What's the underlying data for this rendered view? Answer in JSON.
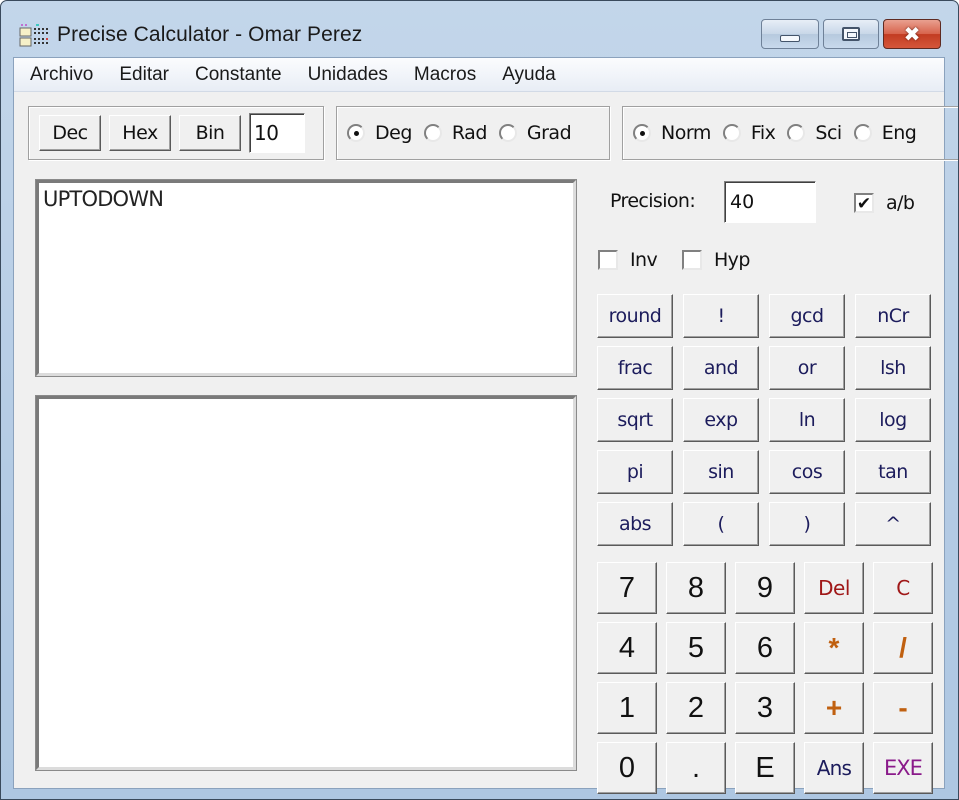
{
  "window": {
    "title": "Precise Calculator - Omar Perez",
    "app_icon": "calculator-icon",
    "controls": {
      "minimize": "minimize-icon",
      "maximize": "maximize-icon",
      "close": "✖"
    }
  },
  "menu": [
    "Archivo",
    "Editar",
    "Constante",
    "Unidades",
    "Macros",
    "Ayuda"
  ],
  "base_group": {
    "buttons": [
      "Dec",
      "Hex",
      "Bin"
    ],
    "base_value": "10"
  },
  "angle_group": {
    "options": [
      {
        "label": "Deg",
        "selected": true
      },
      {
        "label": "Rad",
        "selected": false
      },
      {
        "label": "Grad",
        "selected": false
      }
    ]
  },
  "format_group": {
    "options": [
      {
        "label": "Norm",
        "selected": true
      },
      {
        "label": "Fix",
        "selected": false
      },
      {
        "label": "Sci",
        "selected": false
      },
      {
        "label": "Eng",
        "selected": false
      }
    ]
  },
  "input_area": {
    "value": "UPTODOWN"
  },
  "output_area": {
    "value": ""
  },
  "precision": {
    "label": "Precision:",
    "value": "40"
  },
  "checkboxes": {
    "fraction": {
      "label": "a/b",
      "checked": true,
      "mark": "✔"
    },
    "inv": {
      "label": "Inv",
      "checked": false,
      "mark": ""
    },
    "hyp": {
      "label": "Hyp",
      "checked": false,
      "mark": ""
    }
  },
  "function_buttons": [
    "round",
    "!",
    "gcd",
    "nCr",
    "frac",
    "and",
    "or",
    "lsh",
    "sqrt",
    "exp",
    "ln",
    "log",
    "pi",
    "sin",
    "cos",
    "tan",
    "abs",
    "(",
    ")",
    "^"
  ],
  "keypad": [
    {
      "label": "7",
      "style": "digit"
    },
    {
      "label": "8",
      "style": "digit"
    },
    {
      "label": "9",
      "style": "digit"
    },
    {
      "label": "Del",
      "style": "red"
    },
    {
      "label": "C",
      "style": "red"
    },
    {
      "label": "4",
      "style": "digit"
    },
    {
      "label": "5",
      "style": "digit"
    },
    {
      "label": "6",
      "style": "digit"
    },
    {
      "label": "*",
      "style": "orange"
    },
    {
      "label": "/",
      "style": "orange"
    },
    {
      "label": "1",
      "style": "digit"
    },
    {
      "label": "2",
      "style": "digit"
    },
    {
      "label": "3",
      "style": "digit"
    },
    {
      "label": "+",
      "style": "orange"
    },
    {
      "label": "-",
      "style": "orange"
    },
    {
      "label": "0",
      "style": "digit"
    },
    {
      "label": ".",
      "style": "digit"
    },
    {
      "label": "E",
      "style": "digit"
    },
    {
      "label": "Ans",
      "style": "navy"
    },
    {
      "label": "EXE",
      "style": "purple"
    }
  ],
  "colors": {
    "function_text": "#1c1c5c",
    "clear_text": "#a01818",
    "operator_text": "#c06010",
    "execute_text": "#8a1a8a"
  }
}
